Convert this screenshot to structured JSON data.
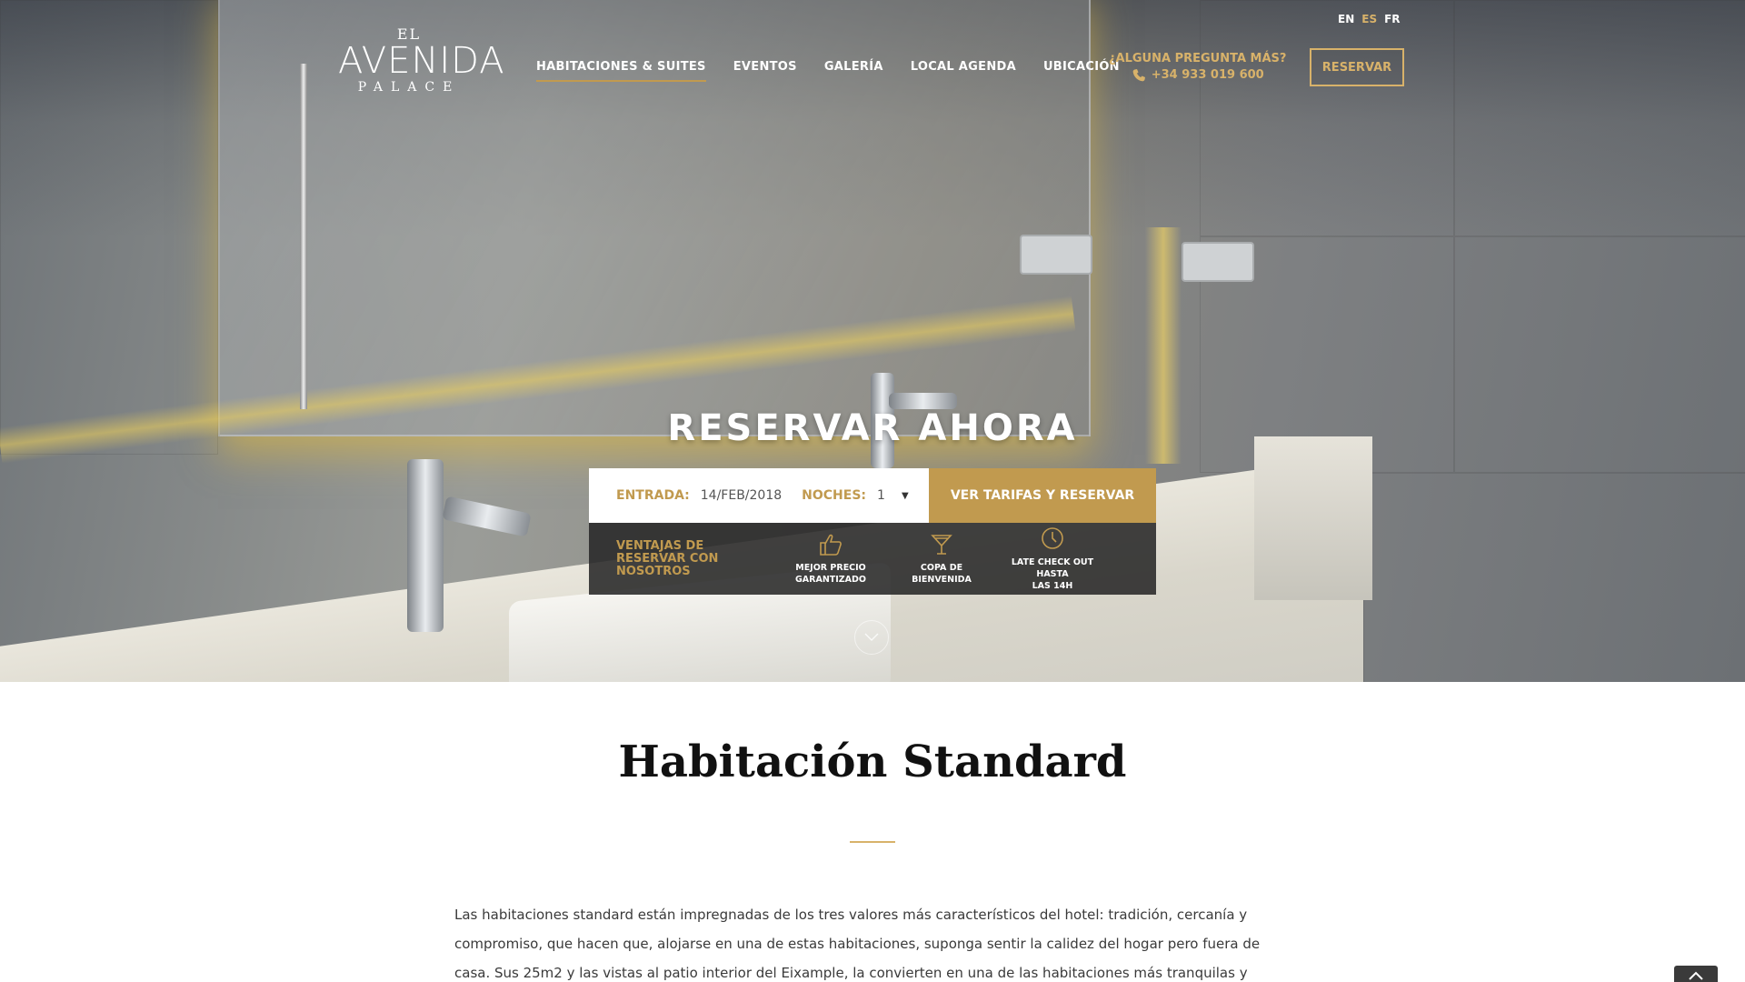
{
  "languages": [
    {
      "code": "EN",
      "active": false
    },
    {
      "code": "ES",
      "active": true
    },
    {
      "code": "FR",
      "active": false
    }
  ],
  "logo": {
    "el": "EL",
    "main": "AVENIDA",
    "sub": "PALACE"
  },
  "nav": {
    "items": [
      {
        "label": "HABITACIONES & SUITES",
        "active": true
      },
      {
        "label": "EVENTOS",
        "active": false
      },
      {
        "label": "GALERÍA",
        "active": false
      },
      {
        "label": "LOCAL AGENDA",
        "active": false
      },
      {
        "label": "UBICACIÓN",
        "active": false
      }
    ]
  },
  "contact": {
    "question": "¿ALGUNA PREGUNTA MÁS?",
    "phone": "+34 933 019 600"
  },
  "header_button": "RESERVAR",
  "booking": {
    "title": "RESERVAR AHORA",
    "entrada_label": "ENTRADA:",
    "entrada_value": "14/FEB/2018",
    "noches_label": "NOCHES:",
    "noches_value": "1",
    "submit": "VER TARIFAS Y RESERVAR",
    "benefits_title": "VENTAJAS DE RESERVAR CON NOSOTROS",
    "benefits": [
      {
        "icon": "thumbs-up-icon",
        "line1": "MEJOR PRECIO",
        "line2": "GARANTIZADO"
      },
      {
        "icon": "cocktail-glass-icon",
        "line1": "COPA DE",
        "line2": "BIENVENIDA"
      },
      {
        "icon": "clock-icon",
        "line1": "LATE CHECK OUT HASTA",
        "line2": "LAS 14H"
      }
    ]
  },
  "room": {
    "title": "Habitación Standard",
    "description": "Las habitaciones standard están impregnadas de los tres valores más característicos del hotel: tradición, cercanía y compromiso, que hacen que, alojarse en una de estas habitaciones, suponga sentir la calidez del hogar pero fuera de casa. Sus 25m2 y las vistas al patio interior del Eixample, la convierten en una de las habitaciones más tranquilas y confortables."
  },
  "colors": {
    "gold": "#c19a4f",
    "gold_light": "#d8b26a",
    "dark_panel": "#282828"
  }
}
